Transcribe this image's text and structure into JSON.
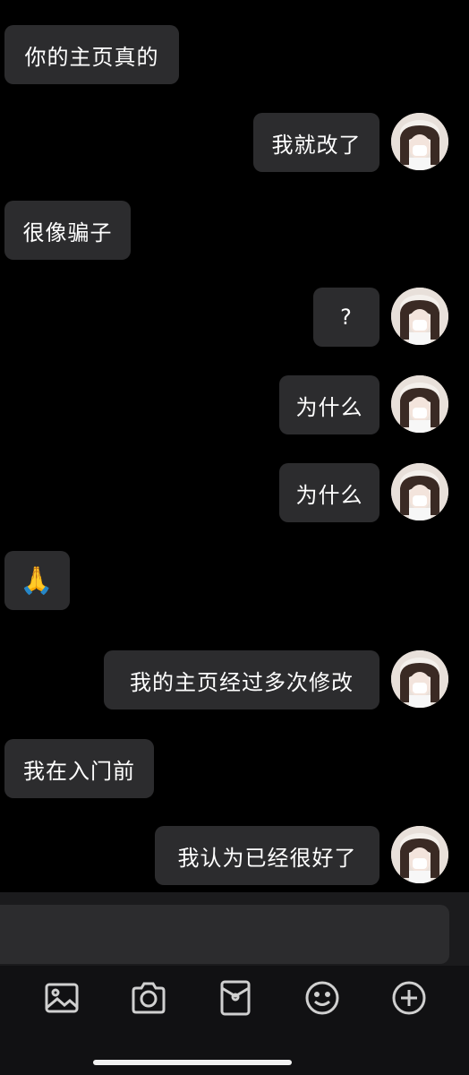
{
  "messages": [
    {
      "side": "left",
      "text": "你的主页真的"
    },
    {
      "side": "right",
      "text": "我就改了"
    },
    {
      "side": "left",
      "text": "很像骗子"
    },
    {
      "side": "right",
      "text": "?"
    },
    {
      "side": "right",
      "text": "为什么"
    },
    {
      "side": "right",
      "text": "为什么"
    },
    {
      "side": "left",
      "text": "🙏"
    },
    {
      "side": "right",
      "text": "我的主页经过多次修改"
    },
    {
      "side": "left",
      "text": "我在入门前"
    },
    {
      "side": "right",
      "text": "我认为已经很好了"
    }
  ],
  "input": {
    "value": "",
    "placeholder": ""
  },
  "toolbar": {
    "icons": [
      "image-icon",
      "camera-icon",
      "sticker-box-icon",
      "emoji-icon",
      "plus-icon"
    ]
  },
  "colors": {
    "background": "#000000",
    "bubble": "#2c2c2e",
    "text": "#ffffff",
    "icon": "#d0d0d0"
  }
}
